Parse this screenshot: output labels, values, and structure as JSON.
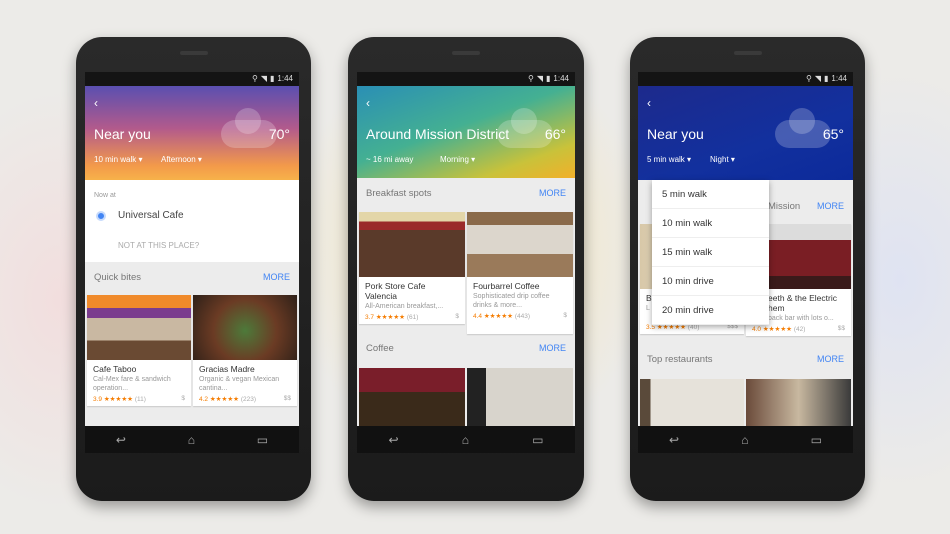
{
  "status": {
    "time": "1:44"
  },
  "nav": {
    "back": "↩",
    "home": "⌂",
    "recents": "▭"
  },
  "phone1": {
    "title": "Near you",
    "temp": "70°",
    "distance": "10 min walk ▾",
    "time_of_day": "Afternoon ▾",
    "now_at": "Now at",
    "place": "Universal Cafe",
    "not_here": "NOT AT THIS PLACE?",
    "section": "Quick bites",
    "more": "MORE",
    "cards": [
      {
        "name": "Cafe Taboo",
        "desc": "Cal-Mex fare & sandwich operation...",
        "rating": "3.9",
        "stars": "★★★★★",
        "reviews": "(11)",
        "price": "$"
      },
      {
        "name": "Gracias Madre",
        "desc": "Organic & vegan Mexican cantina...",
        "rating": "4.2",
        "stars": "★★★★★",
        "reviews": "(223)",
        "price": "$$"
      }
    ]
  },
  "phone2": {
    "title": "Around Mission District",
    "temp": "66°",
    "distance": "~ 16 mi away",
    "time_of_day": "Morning ▾",
    "section1": "Breakfast spots",
    "section2": "Coffee",
    "more": "MORE",
    "cards": [
      {
        "name": "Pork Store Cafe Valencia",
        "desc": "All-American breakfast,...",
        "rating": "3.7",
        "stars": "★★★★★",
        "reviews": "(61)",
        "price": "$"
      },
      {
        "name": "Fourbarrel Coffee",
        "desc": "Sophisticated drip coffee drinks & more...",
        "rating": "4.4",
        "stars": "★★★★★",
        "reviews": "(443)",
        "price": "$"
      }
    ]
  },
  "phone3": {
    "title": "Near you",
    "temp": "65°",
    "distance": "5 min walk ▾",
    "time_of_day": "Night ▾",
    "section1": "Mission",
    "section2": "Top restaurants",
    "more": "MORE",
    "menu": [
      "5 min walk",
      "10 min walk",
      "15 min walk",
      "10 min drive",
      "20 min drive"
    ],
    "cards": [
      {
        "name": "B",
        "desc": "L",
        "rating": "3.5",
        "stars": "★★★★★",
        "reviews": "(40)",
        "price": "$$$"
      },
      {
        "name": "eeth & the Electric hem",
        "desc": "back bar with lots o...",
        "rating": "4.0",
        "stars": "★★★★★",
        "reviews": "(42)",
        "price": "$$"
      }
    ]
  }
}
